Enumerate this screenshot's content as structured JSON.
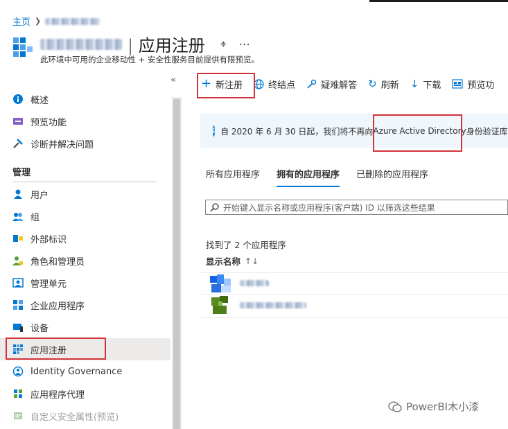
{
  "breadcrumb": {
    "home": "主页"
  },
  "header": {
    "title_suffix": "| 应用注册",
    "subtitle": "此环境中可用的企业移动性 + 安全性服务目前提供有限预览。"
  },
  "sidebar": {
    "top_items": [
      {
        "label": "概述",
        "icon": "info-icon"
      },
      {
        "label": "预览功能",
        "icon": "preview-icon"
      },
      {
        "label": "诊断并解决问题",
        "icon": "wrench-icon"
      }
    ],
    "section_title": "管理",
    "manage_items": [
      {
        "label": "用户",
        "icon": "user-icon"
      },
      {
        "label": "组",
        "icon": "group-icon"
      },
      {
        "label": "外部标识",
        "icon": "external-identity-icon"
      },
      {
        "label": "角色和管理员",
        "icon": "roles-icon"
      },
      {
        "label": "管理单元",
        "icon": "admin-unit-icon"
      },
      {
        "label": "企业应用程序",
        "icon": "enterprise-apps-icon"
      },
      {
        "label": "设备",
        "icon": "devices-icon"
      },
      {
        "label": "应用注册",
        "icon": "app-registration-icon",
        "selected": true
      },
      {
        "label": "Identity Governance",
        "icon": "identity-governance-icon"
      },
      {
        "label": "应用程序代理",
        "icon": "app-proxy-icon"
      },
      {
        "label": "自定义安全属性(预览)",
        "icon": "custom-attributes-icon",
        "disabled": true
      }
    ]
  },
  "toolbar": {
    "new_registration": "新注册",
    "endpoints": "终结点",
    "troubleshoot": "疑难解答",
    "refresh": "刷新",
    "download": "下载",
    "preview": "预览功"
  },
  "banner": {
    "text_before": "自 2020 年 6 月 30 日起，我们将不再向 ",
    "highlight": "Azure Active Directory",
    "text_after": " 身份验证库(A"
  },
  "tabs": [
    {
      "label": "所有应用程序",
      "active": false
    },
    {
      "label": "拥有的应用程序",
      "active": true
    },
    {
      "label": "已删除的应用程序",
      "active": false
    }
  ],
  "search": {
    "placeholder": "开始键入显示名称或应用程序(客户端) ID 以筛选这些结果"
  },
  "results": {
    "count_text": "找到了 2 个应用程序",
    "column_display_name": "显示名称"
  },
  "watermark": {
    "text": "PowerBI木小漆"
  },
  "colors": {
    "accent": "#0078d4",
    "highlight": "#d13438",
    "banner_bg": "#eff6fc"
  }
}
